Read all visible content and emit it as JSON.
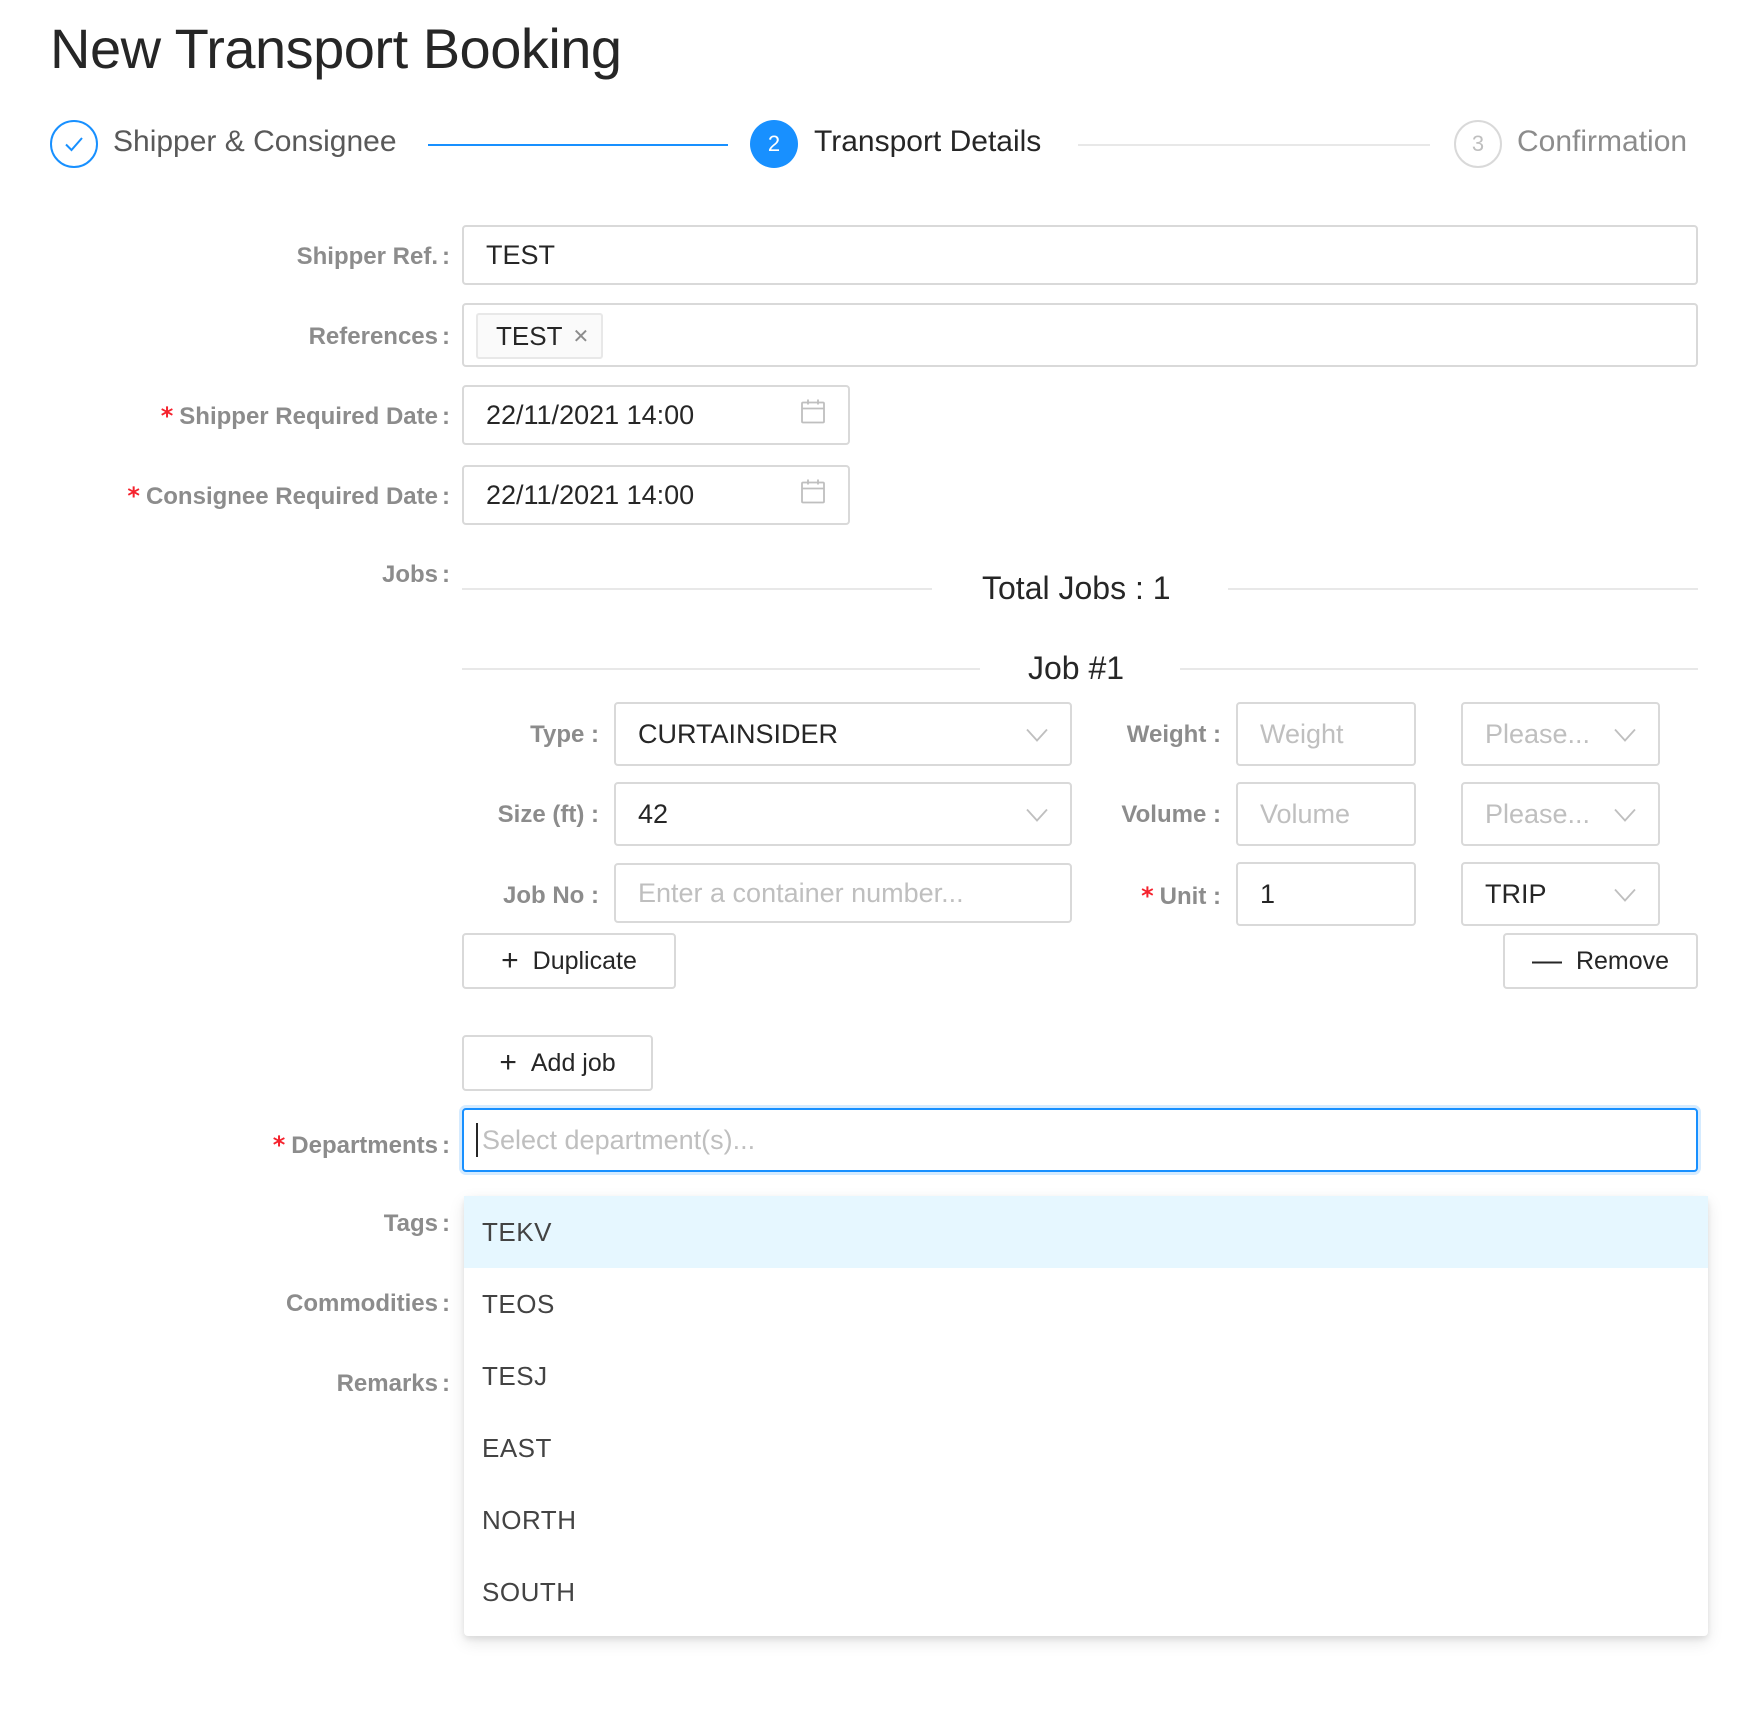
{
  "page": {
    "title": "New Transport Booking"
  },
  "steps": [
    {
      "title": "Shipper & Consignee",
      "status": "done",
      "number": ""
    },
    {
      "title": "Transport Details",
      "status": "active",
      "number": "2"
    },
    {
      "title": "Confirmation",
      "status": "wait",
      "number": "3"
    }
  ],
  "form": {
    "shipper_ref": {
      "label": "Shipper Ref.",
      "value": "TEST"
    },
    "references": {
      "label": "References",
      "tags": [
        "TEST"
      ]
    },
    "shipper_required_date": {
      "label": "Shipper Required Date",
      "value": "22/11/2021 14:00"
    },
    "consignee_required_date": {
      "label": "Consignee Required Date",
      "value": "22/11/2021 14:00"
    },
    "jobs_label": "Jobs",
    "total_jobs": "Total Jobs : 1",
    "departments": {
      "label": "Departments",
      "placeholder": "Select department(s)..."
    },
    "tags_label": "Tags",
    "commodities_label": "Commodities",
    "remarks_label": "Remarks"
  },
  "job": {
    "title": "Job #1",
    "type": {
      "label": "Type",
      "value": "CURTAINSIDER"
    },
    "size": {
      "label": "Size (ft)",
      "value": "42"
    },
    "job_no": {
      "label": "Job No",
      "placeholder": "Enter a container number..."
    },
    "weight": {
      "label": "Weight",
      "placeholder": "Weight",
      "unit_placeholder": "Please..."
    },
    "volume": {
      "label": "Volume",
      "placeholder": "Volume",
      "unit_placeholder": "Please..."
    },
    "unit": {
      "label": "Unit",
      "value": "1",
      "unit_value": "TRIP"
    },
    "duplicate_label": "Duplicate",
    "remove_label": "Remove"
  },
  "add_job_label": "Add job",
  "departments_options": [
    "TEKV",
    "TEOS",
    "TESJ",
    "EAST",
    "NORTH",
    "SOUTH"
  ],
  "colors": {
    "primary": "#1890ff",
    "required": "#f5222d",
    "active_option_bg": "#e6f7ff"
  }
}
